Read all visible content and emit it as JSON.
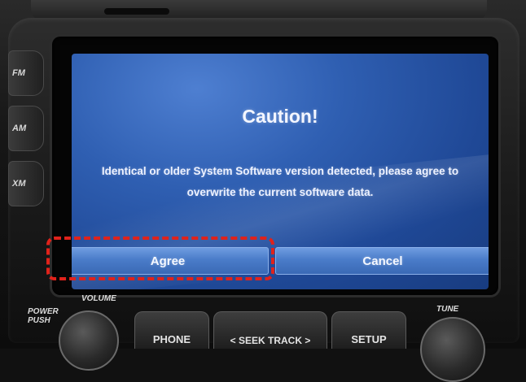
{
  "side_buttons": [
    {
      "label": "FM"
    },
    {
      "label": "AM"
    },
    {
      "label": "XM"
    }
  ],
  "dialog": {
    "title": "Caution!",
    "message": "Identical or older System Software version detected, please agree to overwrite the current software data.",
    "agree_label": "Agree",
    "cancel_label": "Cancel"
  },
  "controls": {
    "power_label": "POWER PUSH",
    "volume_label": "VOLUME",
    "tune_label": "TUNE",
    "phone_label": "PHONE",
    "seek_label": "< SEEK TRACK >",
    "setup_label": "SETUP"
  },
  "colors": {
    "screen_blue": "#2f5fb2",
    "highlight_red": "#e0221b"
  }
}
